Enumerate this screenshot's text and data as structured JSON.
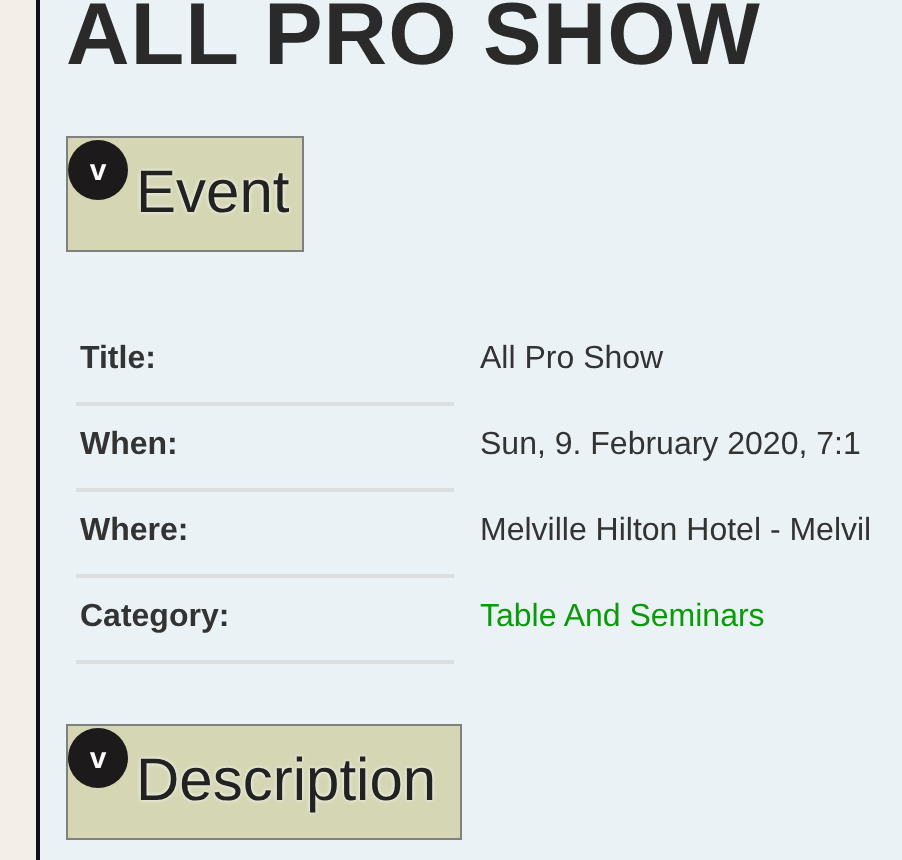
{
  "page_title": "ALL PRO SHOW",
  "sections": [
    {
      "heading": "Event",
      "toggle": "v",
      "expanded": true,
      "rows": [
        {
          "label": "Title:",
          "value": "All Pro Show",
          "kind": "text"
        },
        {
          "label": "When:",
          "value": "Sun, 9. February 2020, 7:1",
          "kind": "text"
        },
        {
          "label": "Where:",
          "value": "Melville Hilton Hotel - Melvil",
          "kind": "text"
        },
        {
          "label": "Category:",
          "value": "Table And Seminars",
          "kind": "link"
        }
      ]
    },
    {
      "heading": "Description",
      "toggle": "v",
      "expanded": true
    }
  ]
}
